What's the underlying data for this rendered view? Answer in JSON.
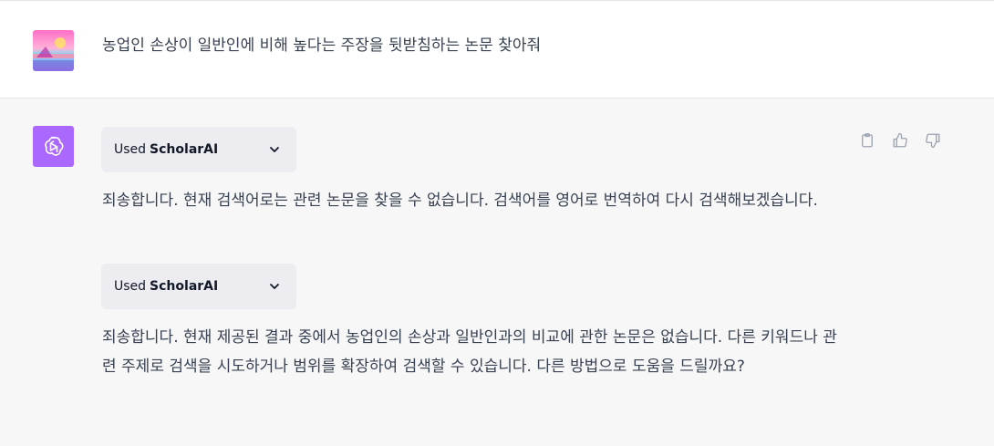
{
  "conversation": {
    "user_message": {
      "text": "농업인 손상이 일반인에 비해 높다는 주장을 뒷받침하는 논문 찾아줘",
      "avatar_icon": "user-avatar-image"
    },
    "assistant_message": {
      "avatar_icon": "openai-logo-icon",
      "avatar_color": "#ab68ff",
      "blocks": [
        {
          "type": "plugin",
          "used_label": "Used",
          "plugin_name": "ScholarAI"
        },
        {
          "type": "text",
          "text": "죄송합니다. 현재 검색어로는 관련 논문을 찾을 수 없습니다. 검색어를 영어로 번역하여 다시 검색해보겠습니다."
        },
        {
          "type": "plugin",
          "used_label": "Used",
          "plugin_name": "ScholarAI"
        },
        {
          "type": "text",
          "text": "죄송합니다. 현재 제공된 결과 중에서 농업인의 손상과 일반인과의 비교에 관한 논문은 없습니다. 다른 키워드나 관련 주제로 검색을 시도하거나 범위를 확장하여 검색할 수 있습니다. 다른 방법으로 도움을 드릴까요?"
        }
      ],
      "actions": [
        "copy-icon",
        "thumbs-up-icon",
        "thumbs-down-icon"
      ]
    }
  }
}
